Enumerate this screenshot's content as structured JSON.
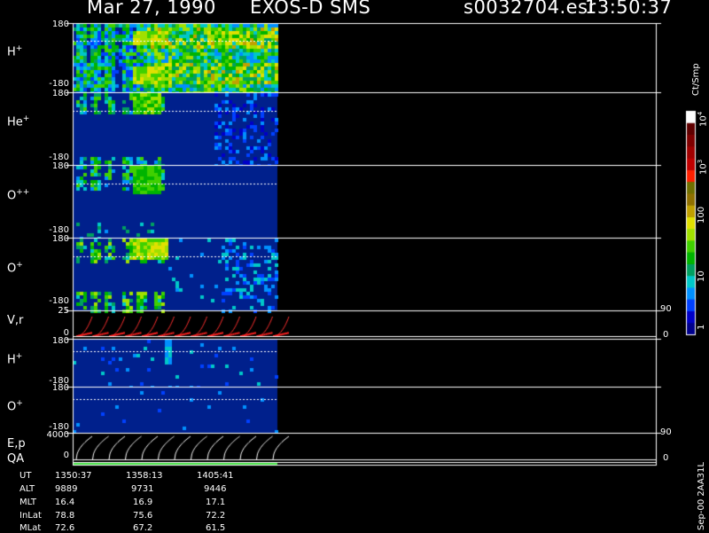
{
  "header": {
    "date": "Mar 27, 1990",
    "instrument": "EXOS-D SMS",
    "file": "s0032704.esr",
    "time": "13:50:37"
  },
  "panels": [
    {
      "id": "hplus",
      "label": "H",
      "sup": "+",
      "ytop": "180",
      "ybot": "-180"
    },
    {
      "id": "heplus",
      "label": "He",
      "sup": "+",
      "ytop": "180",
      "ybot": "-180"
    },
    {
      "id": "oplusplus",
      "label": "O",
      "sup": "++",
      "ytop": "180",
      "ybot": "-180"
    },
    {
      "id": "oplus",
      "label": "O",
      "sup": "+",
      "ytop": "180",
      "ybot": "-180"
    },
    {
      "id": "vr",
      "label": "V,r",
      "sup": "",
      "ytop": "25",
      "ybot": "0",
      "rtop": "90",
      "rbot": "0"
    },
    {
      "id": "hplus2",
      "label": "H",
      "sup": "+",
      "ytop": "180",
      "ybot": "-180"
    },
    {
      "id": "oplus2",
      "label": "O",
      "sup": "+",
      "ytop": "180",
      "ybot": "-180"
    },
    {
      "id": "ep",
      "label": "E,p",
      "sup": "",
      "ytop": "4000",
      "ybot": "0",
      "rtop": "90",
      "rbot": "0"
    },
    {
      "id": "qa",
      "label": "QA",
      "sup": ""
    }
  ],
  "colorbar": {
    "unit": "Ct/Smp",
    "ticks": [
      "1",
      "10",
      "100",
      "10",
      "10"
    ],
    "tick_exps": [
      "",
      "",
      "",
      "3",
      "4"
    ],
    "colors": [
      "#00008c",
      "#0000c8",
      "#0040ff",
      "#0090ff",
      "#00c8c8",
      "#00a060",
      "#00b400",
      "#40d000",
      "#a0e000",
      "#e0e000",
      "#c0a000",
      "#907000",
      "#707000",
      "#ff2000",
      "#c00000",
      "#a00000",
      "#800000",
      "#600000",
      "#ffffff"
    ]
  },
  "footer": {
    "row_labels": [
      "UT",
      "ALT",
      "MLT",
      "InLat",
      "MLat"
    ],
    "columns": [
      [
        "1350:37",
        "9889",
        "16.4",
        "78.8",
        "72.6"
      ],
      [
        "1358:13",
        "9731",
        "16.9",
        "75.6",
        "67.2"
      ],
      [
        "1405:41",
        "9446",
        "17.1",
        "72.2",
        "61.5"
      ]
    ]
  },
  "side_note": "Sep-00  2AA31L",
  "chart_data": {
    "type": "heatmap",
    "title": "Mar 27, 1990   EXOS-D SMS",
    "xlabel": "UT",
    "x_ticks": [
      "1350:37",
      "1358:13",
      "1405:41"
    ],
    "colorbar_scale": "log",
    "colorbar_range": [
      1,
      10000
    ],
    "grid": false
  }
}
